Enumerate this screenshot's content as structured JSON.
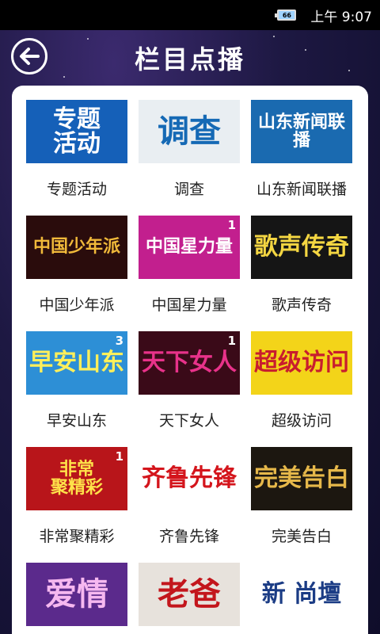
{
  "status_bar": {
    "battery_level": "66",
    "time": "上午 9:07"
  },
  "header": {
    "title": "栏目点播"
  },
  "programs": [
    {
      "label": "专题活动",
      "thumb_text": "专题\n活动",
      "badge": "",
      "bg": "#1560b8",
      "fg": "#ffffff"
    },
    {
      "label": "调查",
      "thumb_text": "调查",
      "badge": "",
      "bg": "#e9eef2",
      "fg": "#1569b5"
    },
    {
      "label": "山东新闻联播",
      "thumb_text": "山东新闻联播",
      "badge": "",
      "bg": "#1a6ab0",
      "fg": "#ffffff"
    },
    {
      "label": "中国少年派",
      "thumb_text": "中国少年派",
      "badge": "",
      "bg": "#2a0c0c",
      "fg": "#f0b93a"
    },
    {
      "label": "中国星力量",
      "thumb_text": "中国星力量",
      "badge": "1",
      "bg": "#c21f8e",
      "fg": "#ffffff"
    },
    {
      "label": "歌声传奇",
      "thumb_text": "歌声传奇",
      "badge": "",
      "bg": "#151515",
      "fg": "#f4d642"
    },
    {
      "label": "早安山东",
      "thumb_text": "早安山东",
      "badge": "3",
      "bg": "#2d8fd6",
      "fg": "#ffef5a"
    },
    {
      "label": "天下女人",
      "thumb_text": "天下女人",
      "badge": "1",
      "bg": "#3a0a18",
      "fg": "#e8328a"
    },
    {
      "label": "超级访问",
      "thumb_text": "超级访问",
      "badge": "",
      "bg": "#f3d419",
      "fg": "#c81d2e"
    },
    {
      "label": "非常聚精彩",
      "thumb_text": "非常\n聚精彩",
      "badge": "1",
      "bg": "#b8151a",
      "fg": "#ffe34a"
    },
    {
      "label": "齐鲁先锋",
      "thumb_text": "齐鲁先锋",
      "badge": "",
      "bg": "#ffffff",
      "fg": "#d4151c"
    },
    {
      "label": "完美告白",
      "thumb_text": "完美告白",
      "badge": "",
      "bg": "#1c1710",
      "fg": "#e6b84a"
    },
    {
      "label": "",
      "thumb_text": "爱情",
      "badge": "",
      "bg": "#5b2a8c",
      "fg": "#f6b8f0"
    },
    {
      "label": "",
      "thumb_text": "老爸",
      "badge": "",
      "bg": "#e7e2dc",
      "fg": "#c3161c"
    },
    {
      "label": "",
      "thumb_text": "新 尚壇",
      "badge": "",
      "bg": "#ffffff",
      "fg": "#1b3c85"
    }
  ]
}
